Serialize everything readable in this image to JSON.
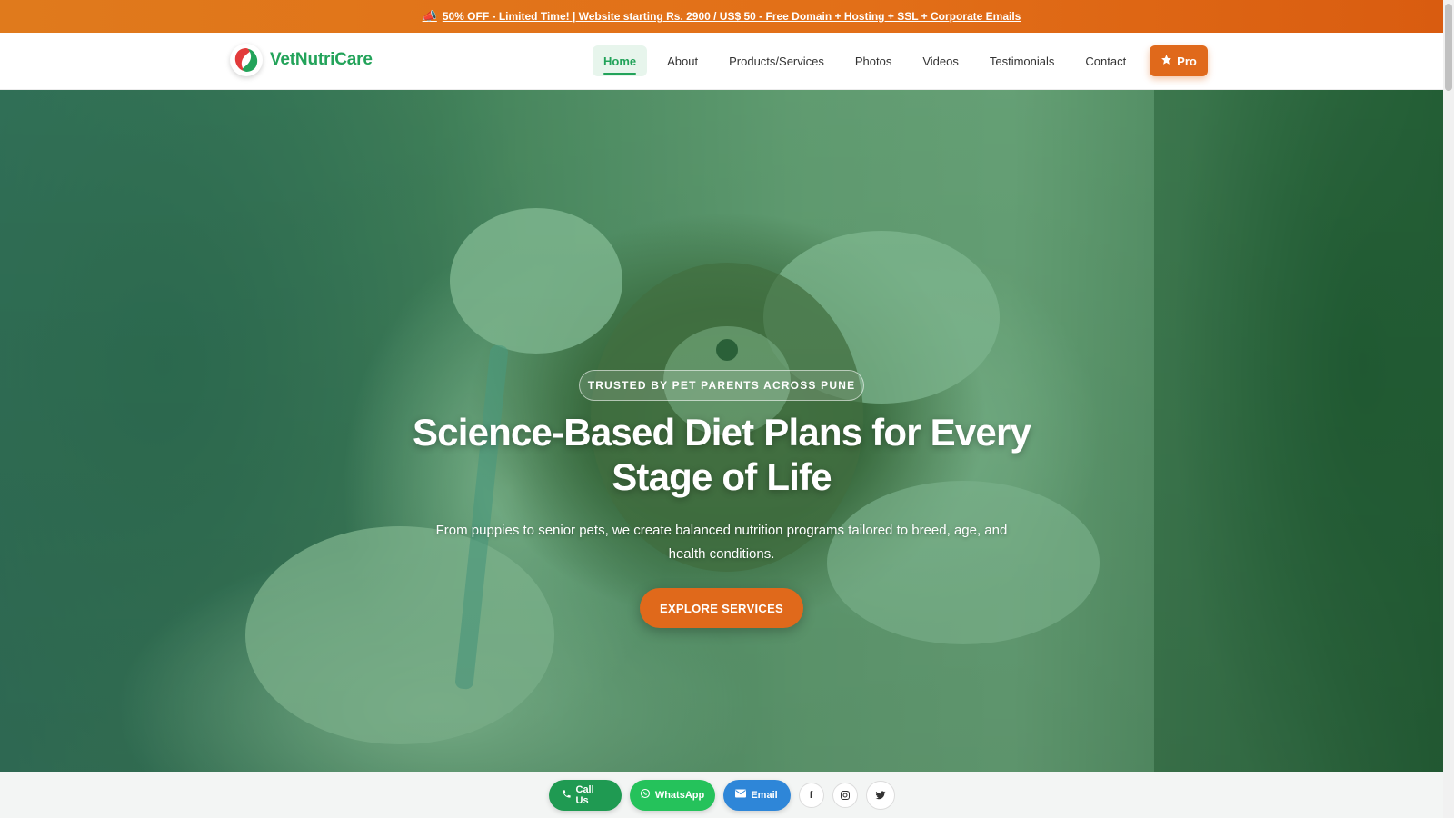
{
  "promo": {
    "icon": "megaphone-icon",
    "text": "50% OFF - Limited Time! | Website starting Rs. 2900 / US$ 50 - Free Domain + Hosting + SSL + Corporate Emails"
  },
  "brand": {
    "name": "VetNutriCare",
    "logo_colors": [
      "#e23b3b",
      "#23a35a"
    ]
  },
  "nav": {
    "items": [
      {
        "label": "Home",
        "active": true
      },
      {
        "label": "About"
      },
      {
        "label": "Products/Services"
      },
      {
        "label": "Photos"
      },
      {
        "label": "Videos"
      },
      {
        "label": "Testimonials"
      },
      {
        "label": "Contact"
      }
    ],
    "pro_label": "Pro"
  },
  "hero": {
    "badge": "TRUSTED BY PET PARENTS ACROSS PUNE",
    "title_line1": "Science-Based Diet Plans for Every",
    "title_line2": "Stage of Life",
    "subtitle": "From puppies to senior pets, we create balanced nutrition programs tailored to breed, age, and health conditions.",
    "cta": "EXPLORE SERVICES",
    "overlay_color": "#249646"
  },
  "contact_bar": {
    "call": "Call Us",
    "whatsapp": "WhatsApp",
    "email": "Email",
    "socials": [
      "facebook-icon",
      "instagram-icon",
      "twitter-icon"
    ]
  },
  "colors": {
    "accent": "#e0691b",
    "brand_green": "#23a35a",
    "whatsapp_green": "#25c25b",
    "email_blue": "#2e86d8"
  }
}
